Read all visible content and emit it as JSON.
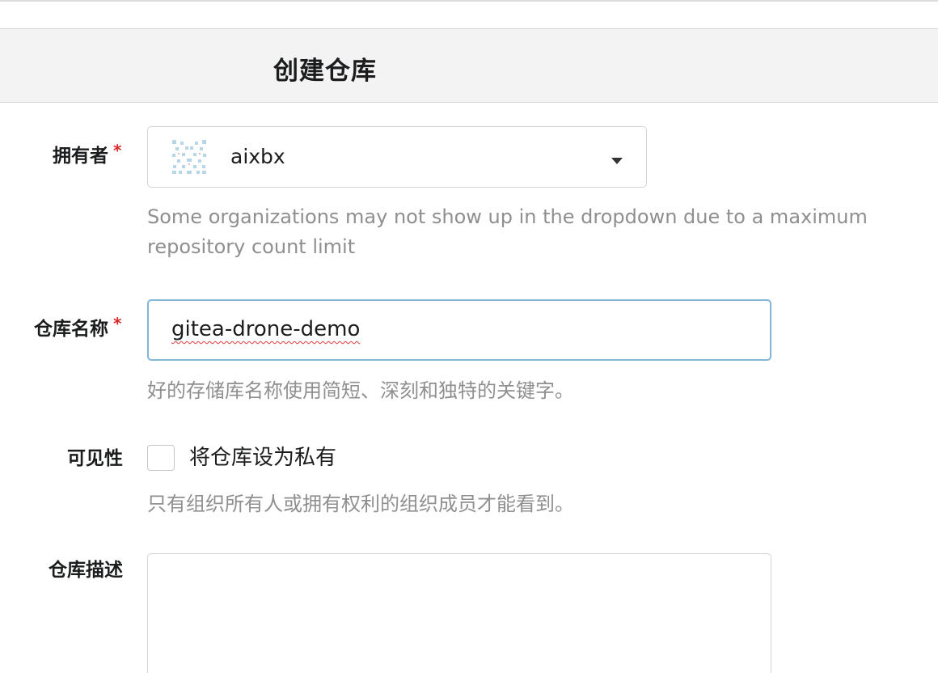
{
  "header": {
    "title": "创建仓库"
  },
  "owner": {
    "label": "拥有者",
    "required_mark": "*",
    "selected": "aixbx",
    "avatar_icon": "identicon",
    "help": "Some organizations may not show up in the dropdown due to a maximum repository count limit"
  },
  "repo_name": {
    "label": "仓库名称",
    "required_mark": "*",
    "value": "gitea-drone-demo",
    "help": "好的存储库名称使用简短、深刻和独特的关键字。"
  },
  "visibility": {
    "label": "可见性",
    "checkbox_label": "将仓库设为私有",
    "checked": false,
    "help": "只有组织所有人或拥有权利的组织成员才能看到。"
  },
  "description": {
    "label": "仓库描述",
    "value": ""
  },
  "colors": {
    "required": "#db2828",
    "focus_border": "#85b7d9",
    "help_text": "#8f8f8f",
    "header_bg": "#f3f3f3"
  }
}
